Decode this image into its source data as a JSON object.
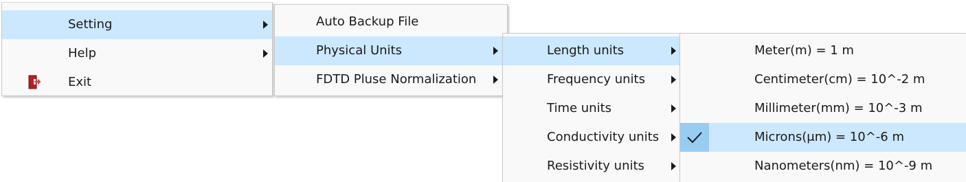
{
  "main_menu": {
    "setting_label": "Setting",
    "help_label": "Help",
    "exit_label": "Exit"
  },
  "setting_menu": {
    "auto_backup_label": "Auto Backup File",
    "physical_units_label": "Physical Units",
    "fdtd_label": "FDTD Pluse Normalization"
  },
  "units_menu": {
    "length_label": "Length units",
    "frequency_label": "Frequency units",
    "time_label": "Time units",
    "conductivity_label": "Conductivity units",
    "resistivity_label": "Resistivity units"
  },
  "length_menu": {
    "meter_label": "Meter(m) = 1 m",
    "centimeter_label": "Centimeter(cm) = 10^-2 m",
    "millimeter_label": "Millimeter(mm) = 10^-3 m",
    "microns_label": "Microns(μm) = 10^-6 m",
    "nanometers_label": "Nanometers(nm) = 10^-9 m",
    "checked_item": "microns"
  },
  "icons": {
    "exit": "exit-door-icon",
    "submenu": "chevron-right-icon",
    "check": "checkmark-icon"
  },
  "colors": {
    "highlight": "#cce8ff",
    "check_background": "#99ccf3",
    "menu_background": "#f9f9f9",
    "exit_icon": "#b22222"
  }
}
